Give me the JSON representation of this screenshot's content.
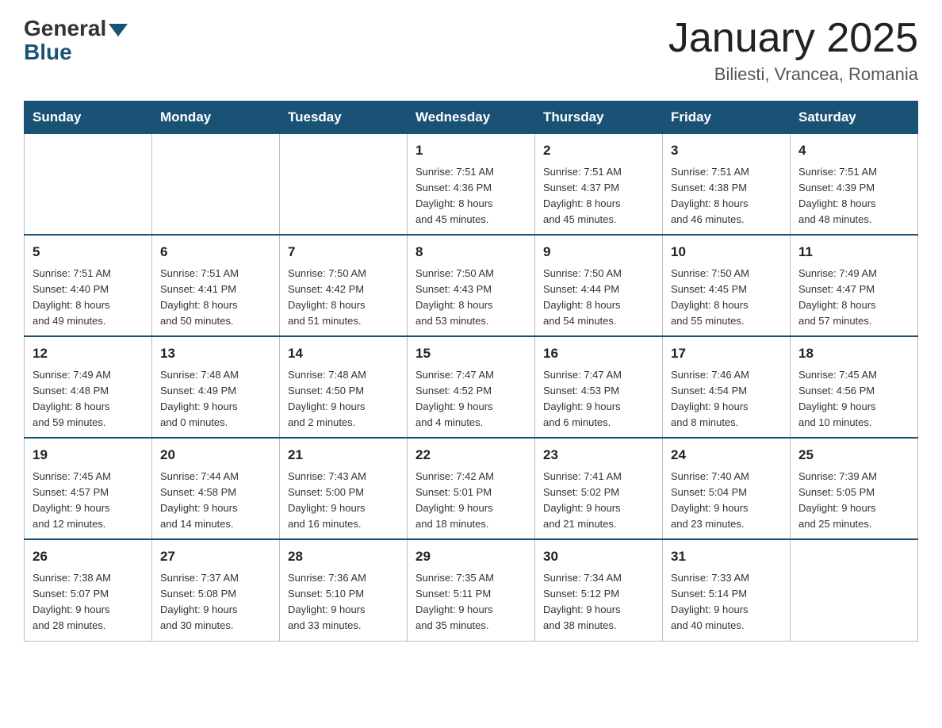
{
  "header": {
    "logo": {
      "general": "General",
      "blue": "Blue"
    },
    "title": "January 2025",
    "location": "Biliesti, Vrancea, Romania"
  },
  "weekdays": [
    "Sunday",
    "Monday",
    "Tuesday",
    "Wednesday",
    "Thursday",
    "Friday",
    "Saturday"
  ],
  "weeks": [
    [
      {
        "day": "",
        "info": ""
      },
      {
        "day": "",
        "info": ""
      },
      {
        "day": "",
        "info": ""
      },
      {
        "day": "1",
        "info": "Sunrise: 7:51 AM\nSunset: 4:36 PM\nDaylight: 8 hours\nand 45 minutes."
      },
      {
        "day": "2",
        "info": "Sunrise: 7:51 AM\nSunset: 4:37 PM\nDaylight: 8 hours\nand 45 minutes."
      },
      {
        "day": "3",
        "info": "Sunrise: 7:51 AM\nSunset: 4:38 PM\nDaylight: 8 hours\nand 46 minutes."
      },
      {
        "day": "4",
        "info": "Sunrise: 7:51 AM\nSunset: 4:39 PM\nDaylight: 8 hours\nand 48 minutes."
      }
    ],
    [
      {
        "day": "5",
        "info": "Sunrise: 7:51 AM\nSunset: 4:40 PM\nDaylight: 8 hours\nand 49 minutes."
      },
      {
        "day": "6",
        "info": "Sunrise: 7:51 AM\nSunset: 4:41 PM\nDaylight: 8 hours\nand 50 minutes."
      },
      {
        "day": "7",
        "info": "Sunrise: 7:50 AM\nSunset: 4:42 PM\nDaylight: 8 hours\nand 51 minutes."
      },
      {
        "day": "8",
        "info": "Sunrise: 7:50 AM\nSunset: 4:43 PM\nDaylight: 8 hours\nand 53 minutes."
      },
      {
        "day": "9",
        "info": "Sunrise: 7:50 AM\nSunset: 4:44 PM\nDaylight: 8 hours\nand 54 minutes."
      },
      {
        "day": "10",
        "info": "Sunrise: 7:50 AM\nSunset: 4:45 PM\nDaylight: 8 hours\nand 55 minutes."
      },
      {
        "day": "11",
        "info": "Sunrise: 7:49 AM\nSunset: 4:47 PM\nDaylight: 8 hours\nand 57 minutes."
      }
    ],
    [
      {
        "day": "12",
        "info": "Sunrise: 7:49 AM\nSunset: 4:48 PM\nDaylight: 8 hours\nand 59 minutes."
      },
      {
        "day": "13",
        "info": "Sunrise: 7:48 AM\nSunset: 4:49 PM\nDaylight: 9 hours\nand 0 minutes."
      },
      {
        "day": "14",
        "info": "Sunrise: 7:48 AM\nSunset: 4:50 PM\nDaylight: 9 hours\nand 2 minutes."
      },
      {
        "day": "15",
        "info": "Sunrise: 7:47 AM\nSunset: 4:52 PM\nDaylight: 9 hours\nand 4 minutes."
      },
      {
        "day": "16",
        "info": "Sunrise: 7:47 AM\nSunset: 4:53 PM\nDaylight: 9 hours\nand 6 minutes."
      },
      {
        "day": "17",
        "info": "Sunrise: 7:46 AM\nSunset: 4:54 PM\nDaylight: 9 hours\nand 8 minutes."
      },
      {
        "day": "18",
        "info": "Sunrise: 7:45 AM\nSunset: 4:56 PM\nDaylight: 9 hours\nand 10 minutes."
      }
    ],
    [
      {
        "day": "19",
        "info": "Sunrise: 7:45 AM\nSunset: 4:57 PM\nDaylight: 9 hours\nand 12 minutes."
      },
      {
        "day": "20",
        "info": "Sunrise: 7:44 AM\nSunset: 4:58 PM\nDaylight: 9 hours\nand 14 minutes."
      },
      {
        "day": "21",
        "info": "Sunrise: 7:43 AM\nSunset: 5:00 PM\nDaylight: 9 hours\nand 16 minutes."
      },
      {
        "day": "22",
        "info": "Sunrise: 7:42 AM\nSunset: 5:01 PM\nDaylight: 9 hours\nand 18 minutes."
      },
      {
        "day": "23",
        "info": "Sunrise: 7:41 AM\nSunset: 5:02 PM\nDaylight: 9 hours\nand 21 minutes."
      },
      {
        "day": "24",
        "info": "Sunrise: 7:40 AM\nSunset: 5:04 PM\nDaylight: 9 hours\nand 23 minutes."
      },
      {
        "day": "25",
        "info": "Sunrise: 7:39 AM\nSunset: 5:05 PM\nDaylight: 9 hours\nand 25 minutes."
      }
    ],
    [
      {
        "day": "26",
        "info": "Sunrise: 7:38 AM\nSunset: 5:07 PM\nDaylight: 9 hours\nand 28 minutes."
      },
      {
        "day": "27",
        "info": "Sunrise: 7:37 AM\nSunset: 5:08 PM\nDaylight: 9 hours\nand 30 minutes."
      },
      {
        "day": "28",
        "info": "Sunrise: 7:36 AM\nSunset: 5:10 PM\nDaylight: 9 hours\nand 33 minutes."
      },
      {
        "day": "29",
        "info": "Sunrise: 7:35 AM\nSunset: 5:11 PM\nDaylight: 9 hours\nand 35 minutes."
      },
      {
        "day": "30",
        "info": "Sunrise: 7:34 AM\nSunset: 5:12 PM\nDaylight: 9 hours\nand 38 minutes."
      },
      {
        "day": "31",
        "info": "Sunrise: 7:33 AM\nSunset: 5:14 PM\nDaylight: 9 hours\nand 40 minutes."
      },
      {
        "day": "",
        "info": ""
      }
    ]
  ]
}
